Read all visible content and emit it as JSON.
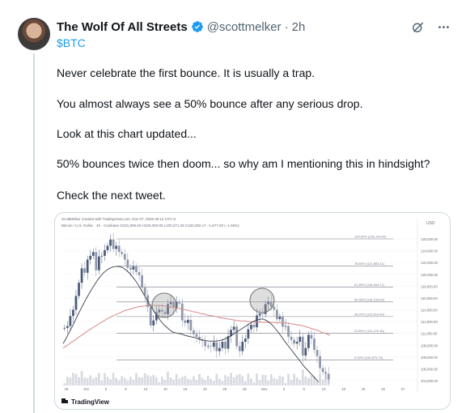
{
  "tweet": {
    "display_name": "The Wolf Of All Streets",
    "handle": "@scottmelker",
    "separator": "·",
    "time": "2h",
    "cashtag": "$BTC",
    "paragraphs": [
      "Never celebrate the first bounce. It is usually a trap.",
      "You almost always see a 50% bounce after any serious drop.",
      "Look at this chart updated...",
      "50% bounces twice then doom... so why am I mentioning this in hindsight?",
      "Check the next tweet."
    ],
    "icons": {
      "verified": "verified-badge-icon",
      "grok": "grok-icon",
      "more": "more-icon"
    }
  },
  "chart": {
    "header": "ScottMelker created with TradingView.com, Nov 07, 2025 00:12 UTC-5",
    "subheader": "Bitcoin / U.S. Dollar · 4h · Coinbase  O101,909.63  H102,000.00  L100,271.29  C100,282.17  −1,677.00 (−1.65%)",
    "price_unit": "USD",
    "brand": "TradingView",
    "fib_levels": [
      {
        "label": "100.00% (126,199.00)",
        "price": 126199
      },
      {
        "label": "78.60% (121,863.11)",
        "price": 121863
      },
      {
        "label": "61.80% (118,494.17)",
        "price": 118494
      },
      {
        "label": "50.00% (116,153.60)",
        "price": 116154
      },
      {
        "label": "38.20% (113,816.69)",
        "price": 113817
      },
      {
        "label": "23.60% (111,176.18)",
        "price": 111176
      },
      {
        "label": "0.00% (106,879.72)",
        "price": 106880
      }
    ],
    "y_ticks": [
      "126,000.00",
      "124,000.00",
      "122,000.00",
      "120,000.00",
      "118,000.00",
      "116,000.00",
      "114,000.00",
      "112,000.00",
      "111,000.00",
      "108,000.00",
      "106,000.00",
      "105,000.00",
      "104,000.00"
    ],
    "x_ticks": [
      "29",
      "Oct",
      "5",
      "9",
      "13",
      "16",
      "19",
      "23",
      "26",
      "29",
      "Nov",
      "5",
      "9",
      "13",
      "16",
      "19",
      "23",
      "27"
    ],
    "closes": [
      112000,
      112300,
      113900,
      114900,
      117100,
      119200,
      121500,
      120800,
      122900,
      123500,
      124100,
      121200,
      123400,
      123500,
      124400,
      125100,
      126100,
      124600,
      125100,
      124100,
      123800,
      122900,
      121600,
      121300,
      121800,
      120900,
      120400,
      118500,
      117200,
      115300,
      112400,
      113200,
      114500,
      114900,
      114600,
      114200,
      115800,
      116100,
      115200,
      116100,
      115900,
      113200,
      112800,
      113300,
      111600,
      111000,
      110600,
      110100,
      109900,
      109100,
      109100,
      109000,
      109700,
      108300,
      108800,
      109800,
      108700,
      110700,
      111700,
      112200,
      109100,
      108300,
      109800,
      110300,
      111800,
      112500,
      112100,
      114000,
      114300,
      114200,
      115800,
      116200,
      115400,
      114900,
      113400,
      113800,
      112200,
      112300,
      110600,
      110100,
      109500,
      109800,
      110600,
      107600,
      108800,
      110900,
      110300,
      108500,
      107500,
      105600,
      105000,
      104700,
      103800
    ],
    "ma_short": [
      109500,
      110300,
      111200,
      112100,
      113000,
      114000,
      114900,
      115800,
      116700,
      117500,
      118300,
      119000,
      119700,
      120300,
      120800,
      121200,
      121500,
      121700,
      121800,
      121800,
      121700,
      121500,
      121100,
      120700,
      120100,
      119500,
      118800,
      118000,
      117200,
      116400,
      115600,
      114900,
      114200,
      113500,
      112900,
      112400,
      112000,
      111600,
      111300,
      111200,
      111100,
      111000,
      110800,
      110700,
      110600,
      110500,
      110400,
      110200,
      110100,
      110000,
      109900,
      109900,
      109900,
      109900,
      110000,
      110100,
      110300,
      110500,
      110800,
      111100,
      111400,
      111700,
      112000,
      112300,
      112600,
      112900,
      113100,
      113300,
      113400,
      113400,
      113200,
      112900,
      112500,
      112000,
      111400,
      110800,
      110100,
      109500,
      108900,
      108300,
      107700,
      107100,
      106500,
      105900,
      105400,
      104900,
      104400,
      103900,
      103400
    ],
    "ma_long": [
      108800,
      109200,
      109700,
      110100,
      110600,
      111000,
      111500,
      111900,
      112300,
      112700,
      113100,
      113500,
      113800,
      114100,
      114400,
      114700,
      114900,
      115100,
      115300,
      115400,
      115500,
      115600,
      115600,
      115600,
      115600,
      115500,
      115400,
      115300,
      115200,
      115100,
      114900,
      114800,
      114600,
      114500,
      114300,
      114200,
      114000,
      113900,
      113800,
      113600,
      113500,
      113400,
      113300,
      113200,
      113100,
      113100,
      113000,
      113000,
      112900,
      112900,
      112900,
      112900,
      112900,
      112800,
      112800,
      112800,
      112700,
      112600,
      112500,
      112400,
      112200,
      112000,
      111800,
      111600,
      111300,
      111100,
      110800
    ]
  }
}
